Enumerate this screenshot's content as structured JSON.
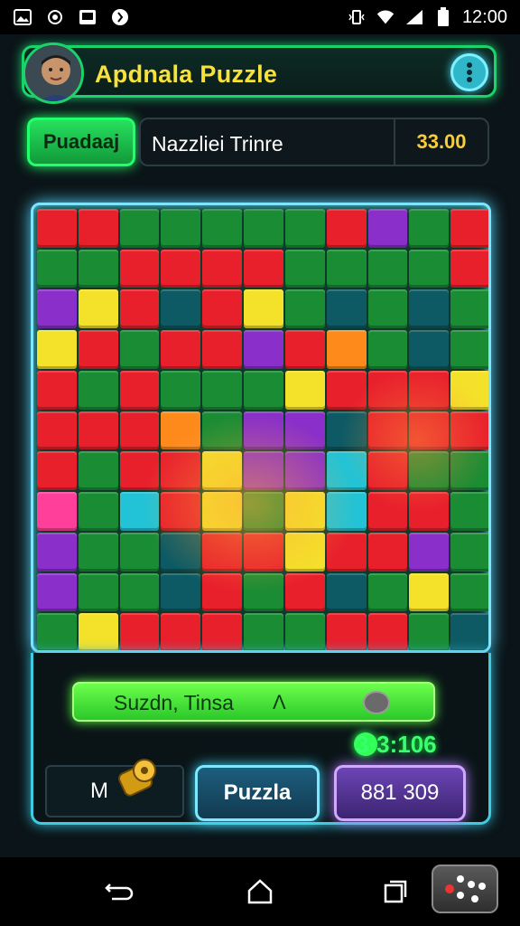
{
  "status_bar": {
    "time": "12:00",
    "left_icons": [
      "gallery-icon",
      "sync-icon",
      "image-icon",
      "app-icon"
    ],
    "right_icons": [
      "vibrate-icon",
      "wifi-icon",
      "signal-icon",
      "battery-icon"
    ]
  },
  "header": {
    "title": "Apdnala Puzzle",
    "avatar_icon": "user-avatar",
    "menu_icon": "more-vertical-icon"
  },
  "toolbar": {
    "mode_label": "Puadaaj",
    "info_label": "Nazzliei Trinre",
    "score": "33.00"
  },
  "board": {
    "rows": [
      [
        "red",
        "red",
        "green",
        "green",
        "green",
        "green",
        "green",
        "red",
        "purple",
        "green",
        "red"
      ],
      [
        "green",
        "green",
        "red",
        "red",
        "red",
        "red",
        "green",
        "green",
        "green",
        "green",
        "red"
      ],
      [
        "purple",
        "yellow",
        "red",
        "teal",
        "red",
        "yellow",
        "green",
        "teal",
        "green",
        "teal",
        "green"
      ],
      [
        "yellow",
        "red",
        "green",
        "red",
        "red",
        "purple",
        "red",
        "orange",
        "green",
        "teal",
        "green"
      ],
      [
        "red",
        "green",
        "red",
        "green",
        "green",
        "green",
        "yellow",
        "red",
        "red",
        "red",
        "yellow"
      ],
      [
        "red",
        "red",
        "red",
        "orange",
        "green",
        "purple",
        "purple",
        "teal",
        "red",
        "red",
        "red"
      ],
      [
        "red",
        "green",
        "red",
        "red",
        "yellow",
        "purple",
        "purple",
        "cyan",
        "red",
        "green",
        "green"
      ],
      [
        "pink",
        "green",
        "cyan",
        "red",
        "yellow",
        "green",
        "yellow",
        "cyan",
        "red",
        "red",
        "green"
      ],
      [
        "purple",
        "green",
        "green",
        "teal",
        "red",
        "red",
        "yellow",
        "red",
        "red",
        "purple",
        "green"
      ],
      [
        "purple",
        "green",
        "green",
        "teal",
        "red",
        "green",
        "red",
        "teal",
        "green",
        "yellow",
        "green"
      ],
      [
        "green",
        "yellow",
        "red",
        "red",
        "red",
        "green",
        "green",
        "red",
        "red",
        "green",
        "teal"
      ]
    ],
    "colors": {
      "red": "#e8202c",
      "green": "#1a8c34",
      "yellow": "#f4e12a",
      "purple": "#8a2fc9",
      "teal": "#0d5a64",
      "orange": "#ff8a1c",
      "pink": "#ff3f9a",
      "cyan": "#22c3d6"
    }
  },
  "progress": {
    "label": "Suzdn, Tinsa",
    "arrow": "Λ"
  },
  "bonus": "3·3:106",
  "buttons": {
    "left_label": "M",
    "puzzle_label": "Puzzla",
    "score_label": "881 309"
  },
  "nav": {
    "back_icon": "back-icon",
    "home_icon": "home-icon",
    "recents_icon": "recents-icon",
    "game_icon": "gamepad-icon"
  }
}
